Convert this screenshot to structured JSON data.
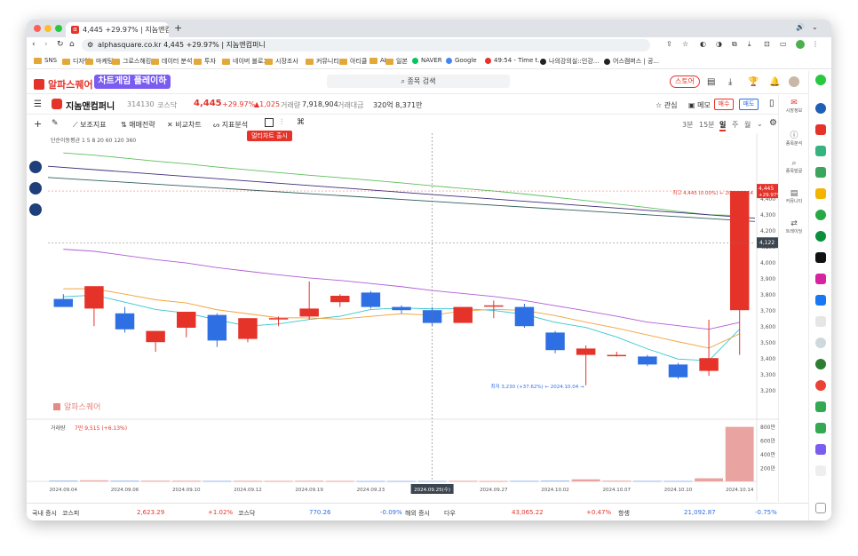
{
  "browser": {
    "tab_title": "4,445 +29.97% | 지놈앤컴퍼니",
    "url": "alphasquare.co.kr  4,445 +29.97% | 지놈앤컴퍼니",
    "bookmarks": [
      "SNS",
      "디자인",
      "마케팅",
      "그로스해킹",
      "데이터 분석",
      "투자",
      "네이버 블로그",
      "시장조사",
      "커뮤니티",
      "아티클",
      "AI",
      "일본",
      "NAVER",
      "Google",
      "49:54 - Time t...",
      "나의강의실::인강...",
      "어스캠퍼스 | 공..."
    ]
  },
  "app": {
    "logo": "알파스퀘어",
    "game_button": "차트게임 플레이하기",
    "search_placeholder": "종목 검색",
    "store_label": "스토어"
  },
  "stock": {
    "name": "지놈앤컴퍼니",
    "code": "314130",
    "market": "코스닥",
    "price": "4,445",
    "change_pct": "+29.97%",
    "change_abs": "▲1,025",
    "volume_label": "거래량",
    "volume": "7,918,904",
    "turnover_label": "거래대금",
    "turnover": "320억 8,371만",
    "watch_label": "관심",
    "memo_label": "메모",
    "buy_label": "매수",
    "sell_label": "매도"
  },
  "toolbar": {
    "items": [
      "보조지표",
      "매매전략",
      "비교차트",
      "지표분석"
    ],
    "tooltip": "멀티차트 출시",
    "periods": [
      "3분",
      "15분",
      "일",
      "주",
      "월"
    ],
    "active_period": "일"
  },
  "chart_data": {
    "type": "candlestick",
    "ma_label": "단순이동평균",
    "ma_periods": [
      "1",
      "5",
      "8",
      "20",
      "60",
      "120",
      "360"
    ],
    "x_ticks": [
      "2024.09.04",
      "2024.09.06",
      "2024.09.10",
      "2024.09.12",
      "2024.09.19",
      "2024.09.23",
      "2024.09.25(수)",
      "2024.09.27",
      "2024.10.02",
      "2024.10.07",
      "2024.10.10",
      "2024.10.14"
    ],
    "y_ticks": [
      3200,
      3300,
      3400,
      3500,
      3600,
      3700,
      3800,
      3900,
      4000,
      4100,
      4200,
      4300,
      4400
    ],
    "ylim": [
      3140,
      4640
    ],
    "candles": [
      {
        "o": 3770,
        "h": 3800,
        "l": 3720,
        "c": 3720
      },
      {
        "o": 3710,
        "h": 3820,
        "l": 3600,
        "c": 3850
      },
      {
        "o": 3680,
        "h": 3720,
        "l": 3560,
        "c": 3580
      },
      {
        "o": 3500,
        "h": 3570,
        "l": 3440,
        "c": 3570
      },
      {
        "o": 3590,
        "h": 3690,
        "l": 3530,
        "c": 3690
      },
      {
        "o": 3670,
        "h": 3680,
        "l": 3470,
        "c": 3510
      },
      {
        "o": 3520,
        "h": 3650,
        "l": 3500,
        "c": 3650
      },
      {
        "o": 3650,
        "h": 3660,
        "l": 3600,
        "c": 3650
      },
      {
        "o": 3660,
        "h": 3880,
        "l": 3640,
        "c": 3710
      },
      {
        "o": 3750,
        "h": 3800,
        "l": 3720,
        "c": 3790
      },
      {
        "o": 3810,
        "h": 3820,
        "l": 3710,
        "c": 3720
      },
      {
        "o": 3720,
        "h": 3730,
        "l": 3680,
        "c": 3700
      },
      {
        "o": 3700,
        "h": 3720,
        "l": 3600,
        "c": 3620
      },
      {
        "o": 3620,
        "h": 3720,
        "l": 3620,
        "c": 3720
      },
      {
        "o": 3730,
        "h": 3760,
        "l": 3650,
        "c": 3730
      },
      {
        "o": 3720,
        "h": 3740,
        "l": 3590,
        "c": 3600
      },
      {
        "o": 3560,
        "h": 3570,
        "l": 3430,
        "c": 3450
      },
      {
        "o": 3420,
        "h": 3480,
        "l": 3230,
        "c": 3460
      },
      {
        "o": 3420,
        "h": 3440,
        "l": 3410,
        "c": 3420
      },
      {
        "o": 3410,
        "h": 3420,
        "l": 3350,
        "c": 3360
      },
      {
        "o": 3360,
        "h": 3370,
        "l": 3270,
        "c": 3280
      },
      {
        "o": 3320,
        "h": 3640,
        "l": 3290,
        "c": 3400
      },
      {
        "o": 3700,
        "h": 4445,
        "l": 3420,
        "c": 4445
      }
    ],
    "current_price_label": "4,445",
    "current_change_label": "+29.97%",
    "crosshair_price_label": "4,122",
    "high_annotation": "최고 4,445 (0.00%) ← 2024.10.14",
    "low_annotation": "최저 3,230 (+37.62%) ← 2024.10.04 →",
    "watermark": "알파스퀘어",
    "volume_label": "거래량",
    "volume_value": "7만 9,515 (+6.13%)",
    "volume_ticks": [
      "800만",
      "600만",
      "400만",
      "200만"
    ],
    "volume_max": 8000000,
    "volumes": [
      120000,
      150000,
      110000,
      100000,
      90000,
      80000,
      80000,
      70000,
      90000,
      70000,
      60000,
      60000,
      70000,
      80000,
      60000,
      90000,
      120000,
      300000,
      100000,
      80000,
      70000,
      450000,
      7918904
    ]
  },
  "footer": {
    "domestic_label": "국내 증시",
    "kospi_label": "코스피",
    "kospi_value": "2,623.29",
    "kospi_change": "+1.02%",
    "kosdaq_label": "코스닥",
    "kosdaq_value": "770.26",
    "kosdaq_change": "-0.09%",
    "overseas_label": "해외 증시",
    "dow_label": "다우",
    "dow_value": "43,065.22",
    "dow_change": "+0.47%",
    "hangseng_label": "항셍",
    "hangseng_value": "21,092.87",
    "hangseng_change": "-0.75%"
  },
  "inner_sidebar": [
    "시장정보",
    "종목분석",
    "종목발굴",
    "커뮤니티",
    "트레이딩"
  ],
  "colors": {
    "up": "#e5332a",
    "down": "#2f6fe4",
    "accent": "#7b5cf0"
  }
}
